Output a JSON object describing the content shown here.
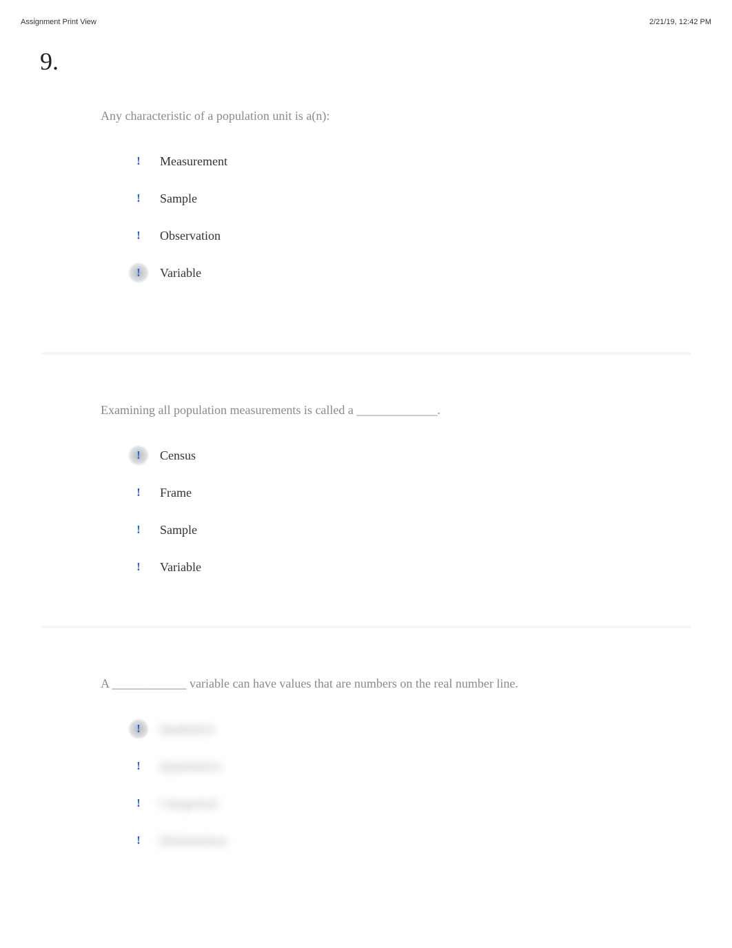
{
  "header": {
    "left": "Assignment Print View",
    "right": "2/21/19, 12:42 PM"
  },
  "questionNumber": "9.",
  "q1": {
    "prompt": "Any characteristic of a population unit is a(n):",
    "options": {
      "a": "Measurement",
      "b": "Sample",
      "c": "Observation",
      "d": "Variable"
    }
  },
  "q2": {
    "prompt": "Examining all population measurements is called a _____________.",
    "options": {
      "a": "Census",
      "b": "Frame",
      "c": "Sample",
      "d": "Variable"
    }
  },
  "q3": {
    "prompt": "A ____________ variable can have values that are numbers on the real number line.",
    "options": {
      "a": "Qualitative",
      "b": "Quantitative",
      "c": "Categorical",
      "d": "Dichotomous"
    }
  },
  "markerGlyph": "!"
}
